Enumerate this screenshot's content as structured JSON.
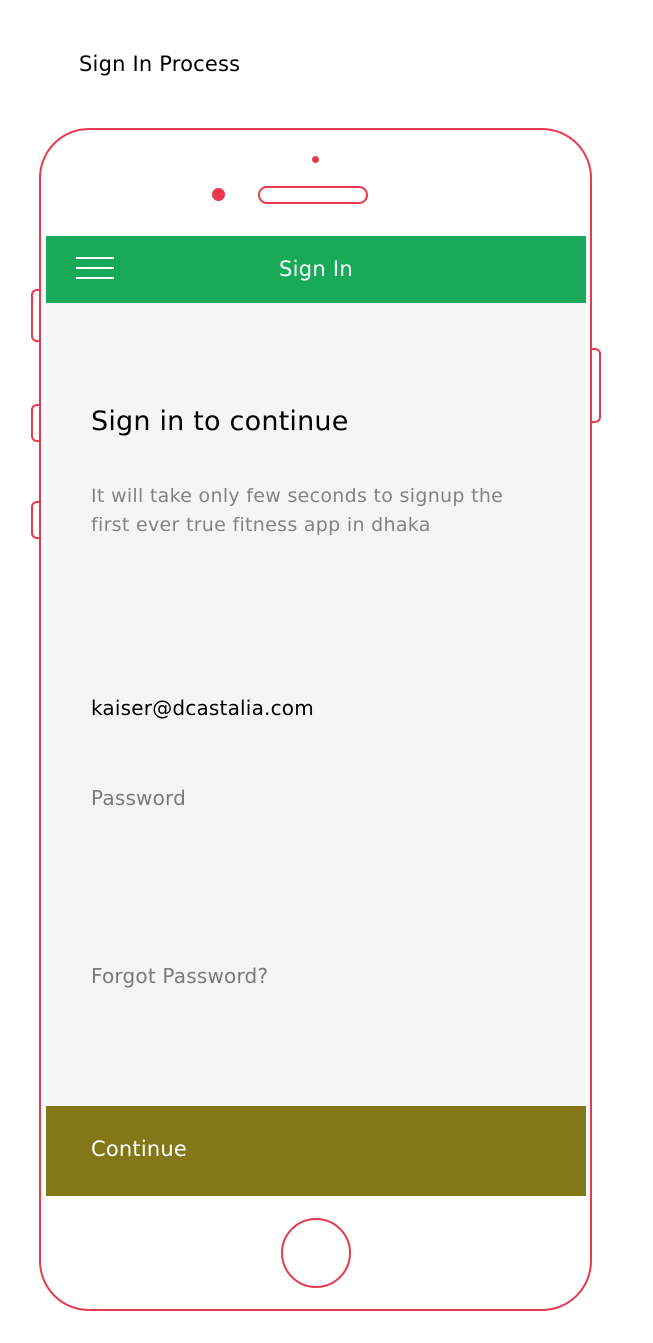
{
  "page": {
    "caption": "Sign In Process"
  },
  "app_bar": {
    "title": "Sign In",
    "menu_icon": "hamburger-menu-icon",
    "background_color": "#19aa59"
  },
  "sign_in": {
    "heading": "Sign in to continue",
    "subtitle": "It will take only few seconds to signup the first ever true fitness app in dhaka",
    "email_value": "kaiser@dcastalia.com",
    "password_placeholder": "Password",
    "forgot_password_label": "Forgot Password?",
    "continue_label": "Continue",
    "continue_color": "#837717"
  },
  "device": {
    "frame_color": "#e8394f"
  }
}
